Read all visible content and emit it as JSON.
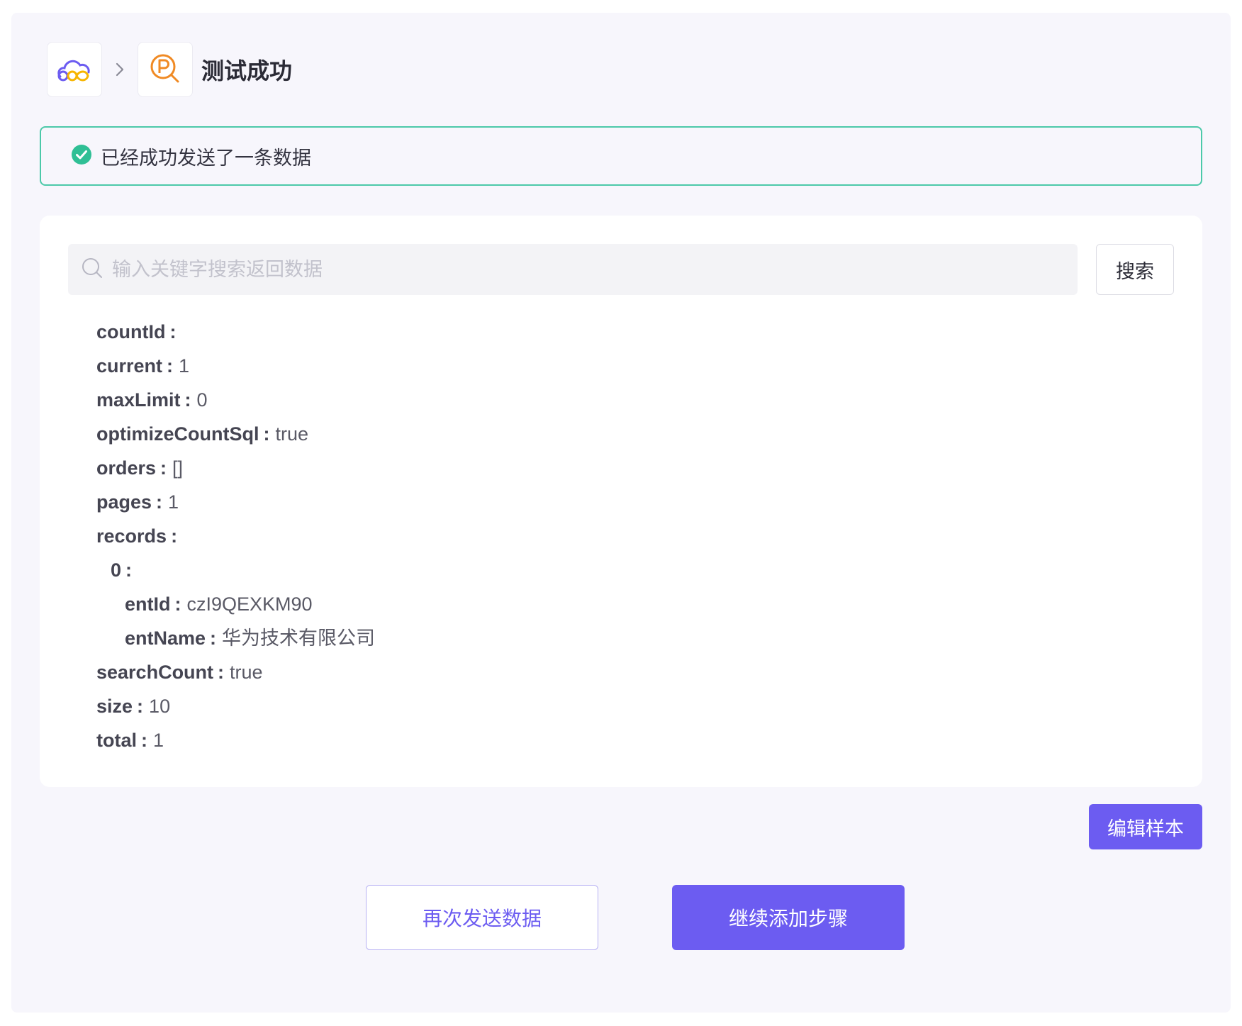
{
  "header": {
    "title": "测试成功",
    "app_icon": "cloud-app-icon",
    "step_icon": "p-search-icon",
    "separator_icon": "chevron-right-icon"
  },
  "banner": {
    "message": "已经成功发送了一条数据",
    "icon": "check-circle-icon",
    "color": "#4cc9a9"
  },
  "search": {
    "placeholder": "输入关键字搜索返回数据",
    "value": "",
    "button_label": "搜索"
  },
  "data": {
    "countId": {
      "key": "countId",
      "colon": ":",
      "value": ""
    },
    "current": {
      "key": "current",
      "colon": ":",
      "value": "1"
    },
    "maxLimit": {
      "key": "maxLimit",
      "colon": ":",
      "value": "0"
    },
    "optimizeCountSql": {
      "key": "optimizeCountSql",
      "colon": ":",
      "value": "true"
    },
    "orders": {
      "key": "orders",
      "colon": ":",
      "value": "[]"
    },
    "pages": {
      "key": "pages",
      "colon": ":",
      "value": "1"
    },
    "records": {
      "key": "records",
      "colon": ":",
      "value": ""
    },
    "records_0": {
      "key": "0",
      "colon": ":",
      "value": ""
    },
    "entId": {
      "key": "entId",
      "colon": ":",
      "value": "czI9QEXKM90"
    },
    "entName": {
      "key": "entName",
      "colon": ":",
      "value": "华为技术有限公司"
    },
    "searchCount": {
      "key": "searchCount",
      "colon": ":",
      "value": "true"
    },
    "size": {
      "key": "size",
      "colon": ":",
      "value": "10"
    },
    "total": {
      "key": "total",
      "colon": ":",
      "value": "1"
    }
  },
  "actions": {
    "edit_sample": "编辑样本",
    "resend": "再次发送数据",
    "continue": "继续添加步骤"
  },
  "colors": {
    "accent": "#6c5cf1",
    "success": "#4cc9a9",
    "background": "#f7f6fc"
  }
}
